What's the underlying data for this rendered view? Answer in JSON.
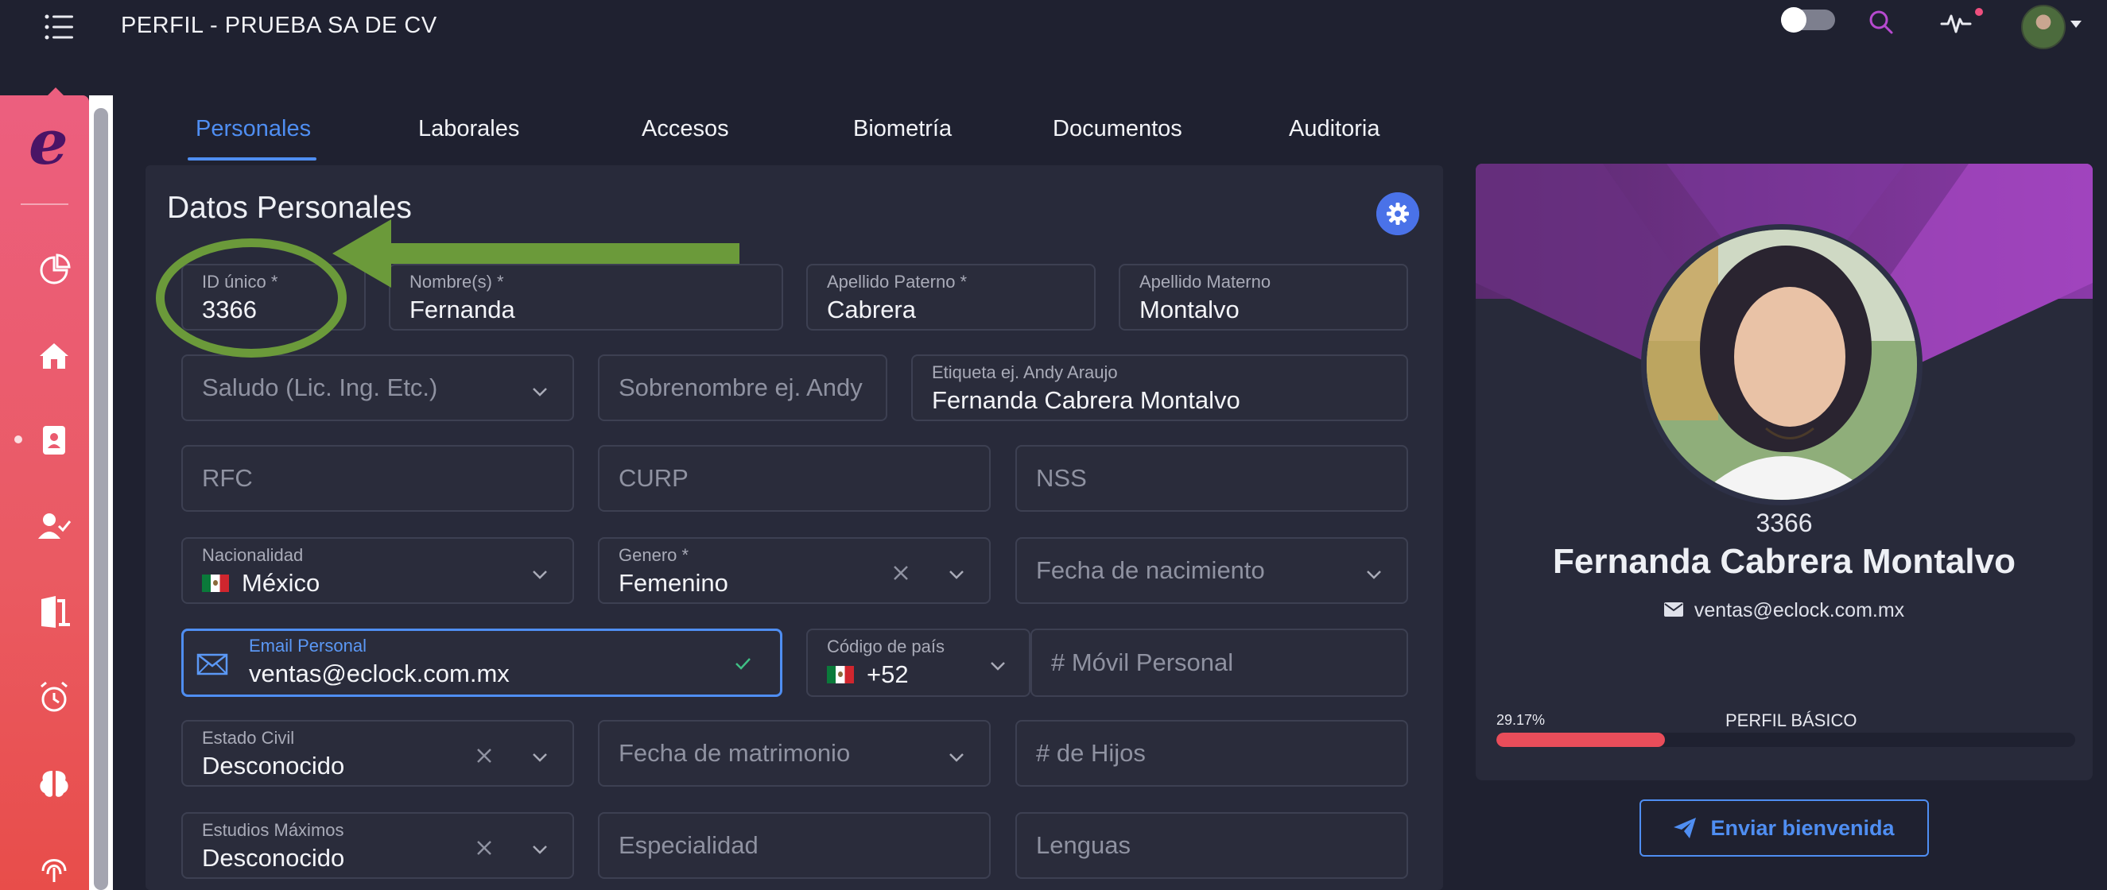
{
  "header": {
    "title": "PERFIL - PRUEBA SA DE CV"
  },
  "tabs": [
    {
      "label": "Personales",
      "active": true
    },
    {
      "label": "Laborales"
    },
    {
      "label": "Accesos"
    },
    {
      "label": "Biometría"
    },
    {
      "label": "Documentos"
    },
    {
      "label": "Auditoria"
    }
  ],
  "section": {
    "title": "Datos Personales"
  },
  "form": {
    "id_unico": {
      "label": "ID único *",
      "value": "3366"
    },
    "nombres": {
      "label": "Nombre(s) *",
      "value": "Fernanda"
    },
    "apellido_paterno": {
      "label": "Apellido Paterno *",
      "value": "Cabrera"
    },
    "apellido_materno": {
      "label": "Apellido Materno",
      "value": "Montalvo"
    },
    "saludo": {
      "placeholder": "Saludo (Lic. Ing. Etc.)"
    },
    "sobrenombre": {
      "placeholder": "Sobrenombre ej. Andy"
    },
    "etiqueta": {
      "label": "Etiqueta ej. Andy Araujo",
      "value": "Fernanda Cabrera Montalvo"
    },
    "rfc": {
      "placeholder": "RFC"
    },
    "curp": {
      "placeholder": "CURP"
    },
    "nss": {
      "placeholder": "NSS"
    },
    "nacionalidad": {
      "label": "Nacionalidad",
      "value": "México"
    },
    "genero": {
      "label": "Genero *",
      "value": "Femenino"
    },
    "fecha_nacimiento": {
      "placeholder": "Fecha de nacimiento"
    },
    "email_personal": {
      "label": "Email Personal",
      "value": "ventas@eclock.com.mx"
    },
    "codigo_pais": {
      "label": "Código de país",
      "value": "+52"
    },
    "movil_personal": {
      "placeholder": "# Móvil Personal"
    },
    "estado_civil": {
      "label": "Estado Civil",
      "value": "Desconocido"
    },
    "fecha_matrimonio": {
      "placeholder": "Fecha de matrimonio"
    },
    "hijos": {
      "placeholder": "# de Hijos"
    },
    "estudios_maximos": {
      "label": "Estudios Máximos",
      "value": "Desconocido"
    },
    "especialidad": {
      "placeholder": "Especialidad"
    },
    "lenguas": {
      "placeholder": "Lenguas"
    }
  },
  "profile": {
    "id": "3366",
    "name": "Fernanda Cabrera Montalvo",
    "email": "ventas@eclock.com.mx",
    "progress_text": "29.17%",
    "progress_value": 0.2917,
    "progress_title": "PERFIL BÁSICO",
    "welcome_button": "Enviar bienvenida"
  },
  "colors": {
    "accent": "#4f8ef2",
    "sidebar_top": "#ec5f7f",
    "sidebar_bottom": "#e84d4a",
    "annotation": "#6b9a3a",
    "progress": "#e94d5a"
  }
}
